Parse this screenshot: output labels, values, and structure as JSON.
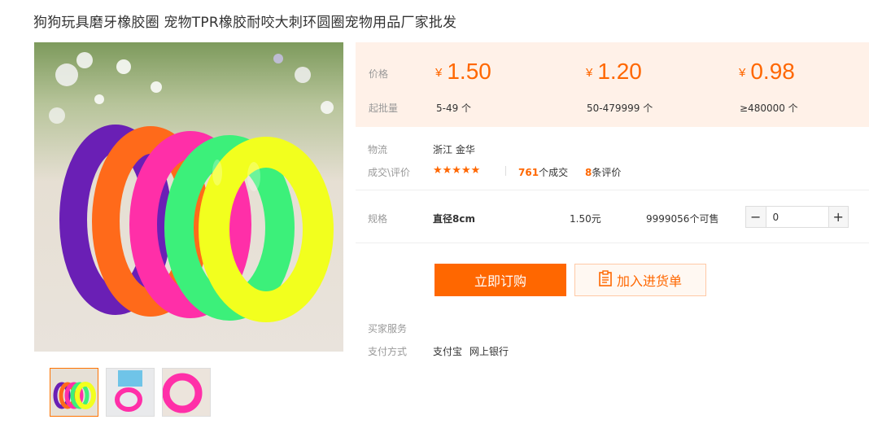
{
  "product": {
    "title": "狗狗玩具磨牙橡胶圈 宠物TPR橡胶耐咬大刺环圆圈宠物用品厂家批发"
  },
  "pricing": {
    "price_label": "价格",
    "moq_label": "起批量",
    "currency": "¥",
    "tiers": [
      {
        "price": "1.50",
        "range": "5-49 个"
      },
      {
        "price": "1.20",
        "range": "50-479999 个"
      },
      {
        "price": "0.98",
        "range": "≥480000 个"
      }
    ]
  },
  "logistics": {
    "label": "物流",
    "origin": "浙江 金华"
  },
  "reviews": {
    "label": "成交\\评价",
    "rating": 4.5,
    "stars": "★★★★★",
    "deals_count": "761",
    "deals_suffix": "个成交",
    "review_count": "8",
    "review_suffix": "条评价"
  },
  "spec": {
    "label": "规格",
    "name": "直径8cm",
    "price": "1.50元",
    "stock": "9999056个可售",
    "quantity": "0",
    "minus": "−",
    "plus": "+"
  },
  "actions": {
    "buy_label": "立即订购",
    "cart_label": "加入进货单"
  },
  "services": {
    "label": "买家服务"
  },
  "payment": {
    "label": "支付方式",
    "methods": [
      "支付宝",
      "网上银行"
    ]
  },
  "colors": {
    "accent": "#ff6700",
    "price_bg": "#fff1e8",
    "ring_purple": "#6a1fb5",
    "ring_orange": "#ff6a1a",
    "ring_pink": "#ff2fa8",
    "ring_green": "#3cf07a",
    "ring_yellow": "#f2ff1e"
  }
}
